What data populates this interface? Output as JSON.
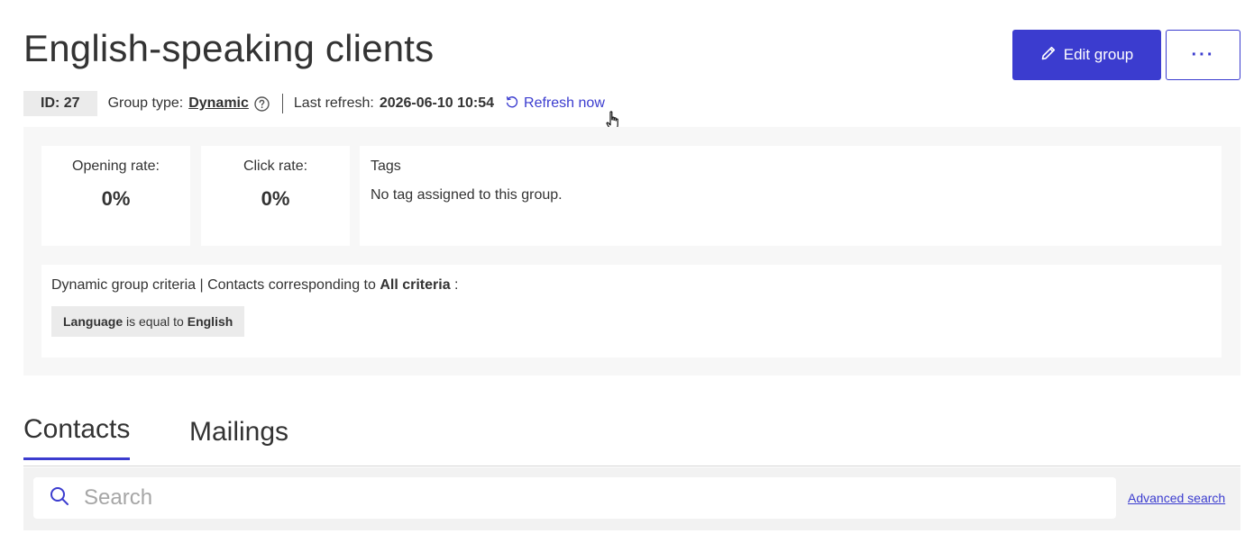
{
  "header": {
    "title": "English-speaking clients",
    "edit_button_label": "Edit group",
    "more_button_label": "···",
    "accent_color": "#3b3ccf"
  },
  "meta": {
    "id_label": "ID: 27",
    "group_type_label": "Group type:",
    "group_type_value": "Dynamic",
    "last_refresh_label": "Last refresh:",
    "last_refresh_value": "2026-06-10 10:54",
    "refresh_link": "Refresh now"
  },
  "stats": {
    "opening_rate_label": "Opening rate:",
    "opening_rate_value": "0%",
    "click_rate_label": "Click rate:",
    "click_rate_value": "0%",
    "tags_title": "Tags",
    "tags_empty": "No tag assigned to this group."
  },
  "criteria": {
    "prefix": "Dynamic group criteria | Contacts corresponding to",
    "mode": "All criteria",
    "suffix": ":",
    "rule_field": "Language",
    "rule_operator": "is equal to",
    "rule_value": "English"
  },
  "tabs": [
    {
      "label": "Contacts",
      "active": true
    },
    {
      "label": "Mailings",
      "active": false
    }
  ],
  "search": {
    "placeholder": "Search",
    "advanced_link": "Advanced search"
  },
  "icons": {
    "edit": "pencil-icon",
    "help": "question-circle-icon",
    "refresh": "refresh-icon",
    "search": "search-icon",
    "cursor": "hand-pointer-icon"
  }
}
